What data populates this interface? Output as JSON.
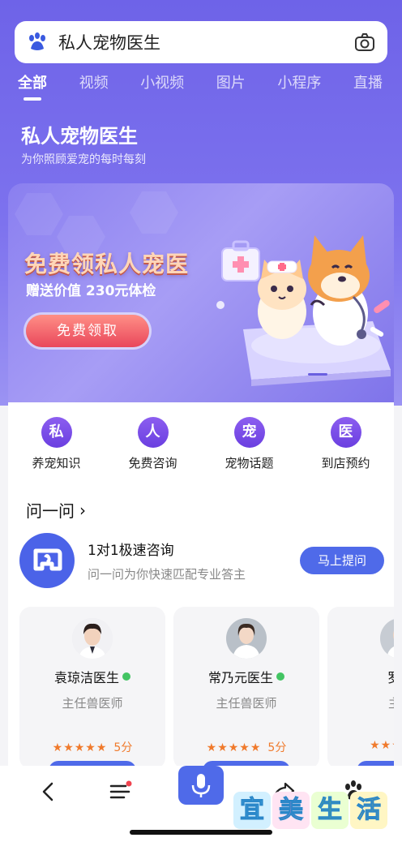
{
  "search": {
    "query": "私人宠物医生"
  },
  "tabs": [
    {
      "label": "全部"
    },
    {
      "label": "视频"
    },
    {
      "label": "小视频"
    },
    {
      "label": "图片"
    },
    {
      "label": "小程序"
    },
    {
      "label": "直播"
    }
  ],
  "brand": {
    "title": "私人宠物医生",
    "subtitle": "为你照顾爱宠的每时每刻"
  },
  "banner": {
    "title": "免费领私人宠医",
    "subtitle": "赠送价值 230元体检",
    "button": "免费领取"
  },
  "quick_links": [
    {
      "icon_char": "私",
      "label": "养宠知识"
    },
    {
      "icon_char": "人",
      "label": "免费咨询"
    },
    {
      "icon_char": "宠",
      "label": "宠物话题"
    },
    {
      "icon_char": "医",
      "label": "到店预约"
    }
  ],
  "ask": {
    "heading": "问一问",
    "consult_title": "1对1极速咨询",
    "consult_desc": "问一问为你快速匹配专业答主",
    "button": "马上提问"
  },
  "doctors": [
    {
      "name": "袁琼洁医生",
      "role": "主任兽医师",
      "score": "5分",
      "online": true
    },
    {
      "name": "常乃元医生",
      "role": "主任兽医师",
      "score": "5分",
      "online": true
    },
    {
      "name": "罗嘉",
      "role": "主任",
      "score": "",
      "online": false
    }
  ],
  "watermark": [
    "宜",
    "美",
    "生",
    "活"
  ],
  "colors": {
    "primary": "#6e63e8",
    "accent_blue": "#4f6ae9",
    "star": "#f07a2c",
    "online": "#43c463"
  }
}
